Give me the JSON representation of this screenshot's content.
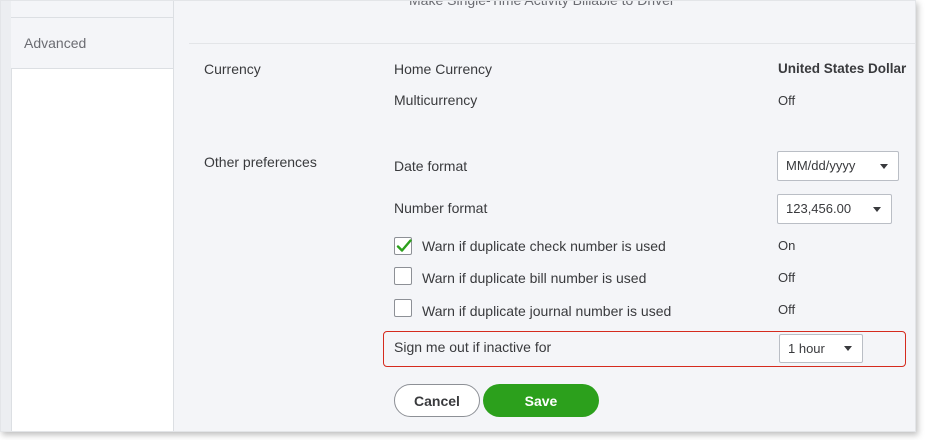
{
  "sidebar": {
    "advanced_label": "Advanced"
  },
  "cutoff": {
    "text": "Make Single-Time Activity Billable to Driver"
  },
  "currency": {
    "section_label": "Currency",
    "home_currency_label": "Home Currency",
    "home_currency_value": "United States Dollar",
    "multicurrency_label": "Multicurrency",
    "multicurrency_value": "Off"
  },
  "other": {
    "section_label": "Other preferences",
    "date_format_label": "Date format",
    "date_format_value": "MM/dd/yyyy",
    "number_format_label": "Number format",
    "number_format_value": "123,456.00",
    "warn_check": {
      "label": "Warn if duplicate check number is used",
      "checked": true,
      "value": "On"
    },
    "warn_bill": {
      "label": "Warn if duplicate bill number is used",
      "checked": false,
      "value": "Off"
    },
    "warn_journal": {
      "label": "Warn if duplicate journal number is used",
      "checked": false,
      "value": "Off"
    },
    "signout_label": "Sign me out if inactive for",
    "signout_value": "1 hour"
  },
  "actions": {
    "cancel_label": "Cancel",
    "save_label": "Save"
  },
  "colors": {
    "save_green": "#2ca01c",
    "check_green": "#2ca01c",
    "highlight_red": "#d52b1e"
  },
  "icons": {
    "check": "check-icon",
    "caret": "caret-down-icon"
  }
}
